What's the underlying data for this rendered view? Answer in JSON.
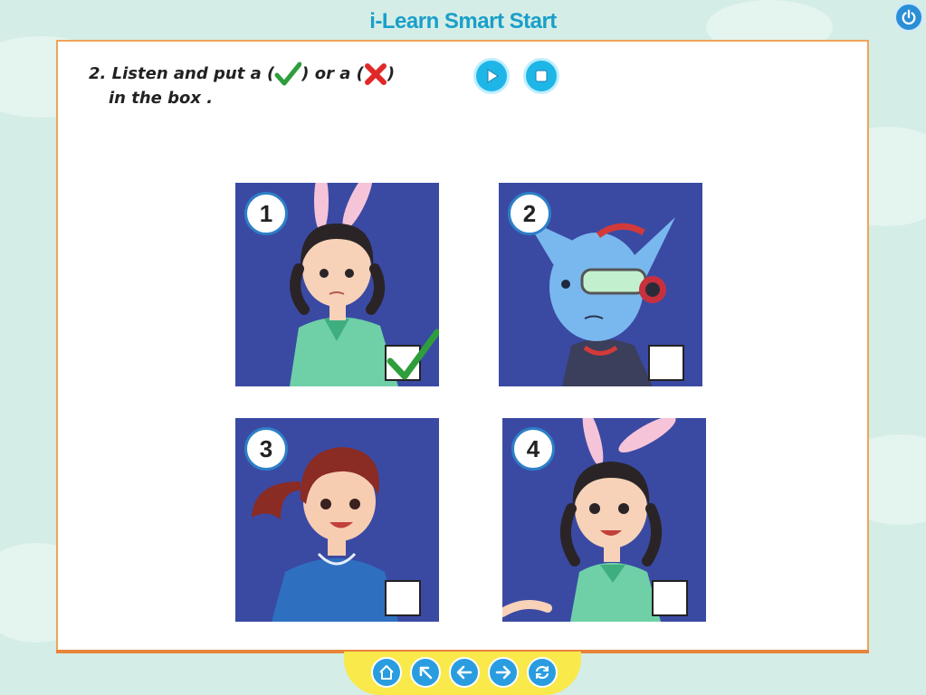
{
  "app": {
    "title": "i-Learn Smart Start"
  },
  "exercise": {
    "number_label": "2.",
    "line1_before": "Listen and put a (",
    "line1_middle": ") or a (",
    "line1_after": ")",
    "line2": "in the box ."
  },
  "audio": {
    "play_icon": "play-icon",
    "stop_icon": "stop-icon"
  },
  "cards": [
    {
      "number": "1",
      "character": "girl with bunny ears, worried",
      "answer": "tick"
    },
    {
      "number": "2",
      "character": "blue alien",
      "answer": ""
    },
    {
      "number": "3",
      "character": "girl with red ponytail, smiling",
      "answer": ""
    },
    {
      "number": "4",
      "character": "girl with bunny ears, smiling",
      "answer": ""
    }
  ],
  "nav": [
    "home-icon",
    "arrow-up-left-icon",
    "arrow-left-icon",
    "arrow-right-icon",
    "refresh-icon"
  ],
  "colors": {
    "title": "#1a9fc9",
    "panel_border": "#f0a35a",
    "card_bg": "#3a4aa3",
    "tick": "#2e9e3c",
    "cross": "#e02828",
    "nav_bar": "#f9e94a"
  }
}
